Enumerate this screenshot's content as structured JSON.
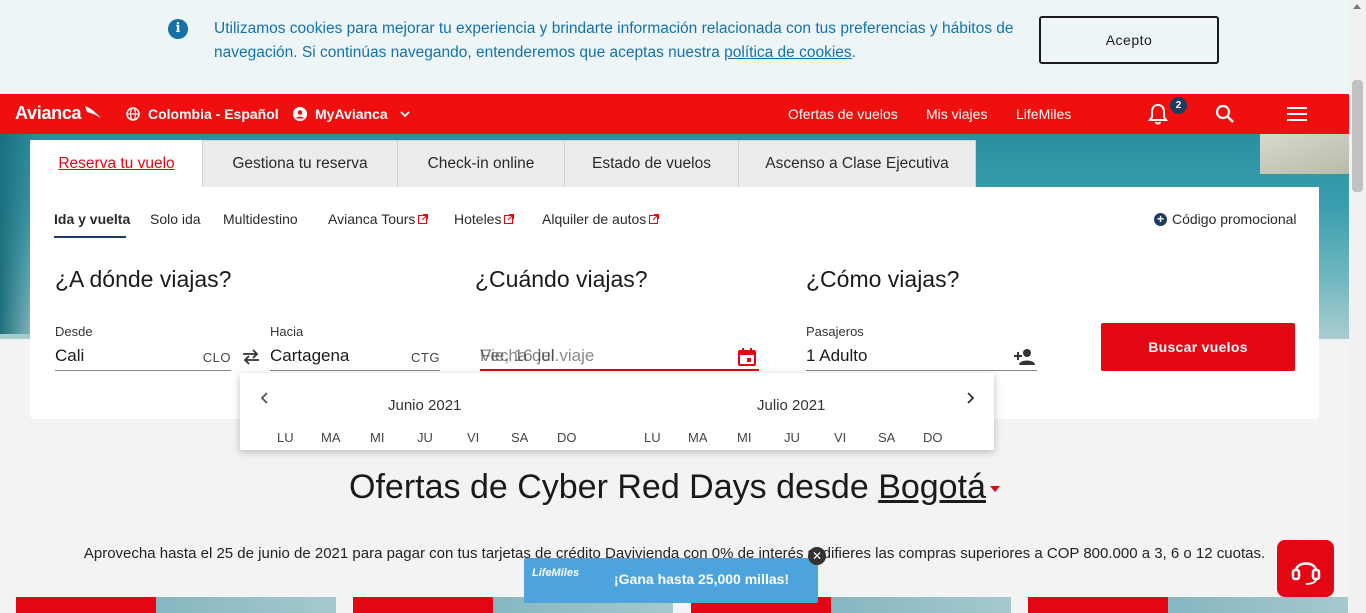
{
  "cookie": {
    "message_part1": "Utilizamos cookies para mejorar tu experiencia y brindarte información relacionada con tus preferencias y hábitos de navegación. Si continúas navegando, entenderemos que aceptas nuestra ",
    "link": "política de cookies",
    "message_end": ".",
    "accept_label": "Acepto"
  },
  "nav": {
    "logo": "Avianca",
    "country": "Colombia - Español",
    "myavianca": "MyAvianca",
    "links": [
      "Ofertas de vuelos",
      "Mis viajes",
      "LifeMiles"
    ],
    "notifications_count": "2"
  },
  "tabs": [
    "Reserva tu vuelo",
    "Gestiona tu reserva",
    "Check-in online",
    "Estado de vuelos",
    "Ascenso a Clase Ejecutiva"
  ],
  "subtabs": [
    "Ida y vuelta",
    "Solo ida",
    "Multidestino",
    "Avianca Tours",
    "Hoteles",
    "Alquiler de autos"
  ],
  "promo": "Código promocional",
  "sections": {
    "where": "¿A dónde viajas?",
    "when": "¿Cuándo viajas?",
    "how": "¿Cómo viajas?"
  },
  "form": {
    "from_label": "Desde",
    "from_value": "Cali",
    "from_code": "CLO",
    "to_label": "Hacia",
    "to_value": "Cartagena",
    "to_code": "CTG",
    "date_placeholder": "Fecha del viaje",
    "date_value": "Vie, 16 jul.",
    "pax_label": "Pasajeros",
    "pax_value": "1 Adulto",
    "search_button": "Buscar vuelos"
  },
  "calendar": {
    "months": [
      "Junio 2021",
      "Julio 2021"
    ],
    "weekdays": [
      "LU",
      "MA",
      "MI",
      "JU",
      "VI",
      "SA",
      "DO"
    ]
  },
  "offers": {
    "title_prefix": "Ofertas de Cyber Red Days desde ",
    "city": "Bogotá",
    "subtitle": "Aprovecha hasta el 25 de junio de 2021 para pagar con tus tarjetas de crédito Davivienda con 0% de interés si difieres las compras superiores a COP 800.000 a 3, 6 o 12 cuotas."
  },
  "lifemiles_banner": {
    "logo": "LifeMiles",
    "text": "¡Gana hasta 25,000 millas!"
  },
  "colors": {
    "brand_red": "#ef0f0f",
    "info_blue": "#1472a8",
    "navy": "#1e3a5f"
  }
}
